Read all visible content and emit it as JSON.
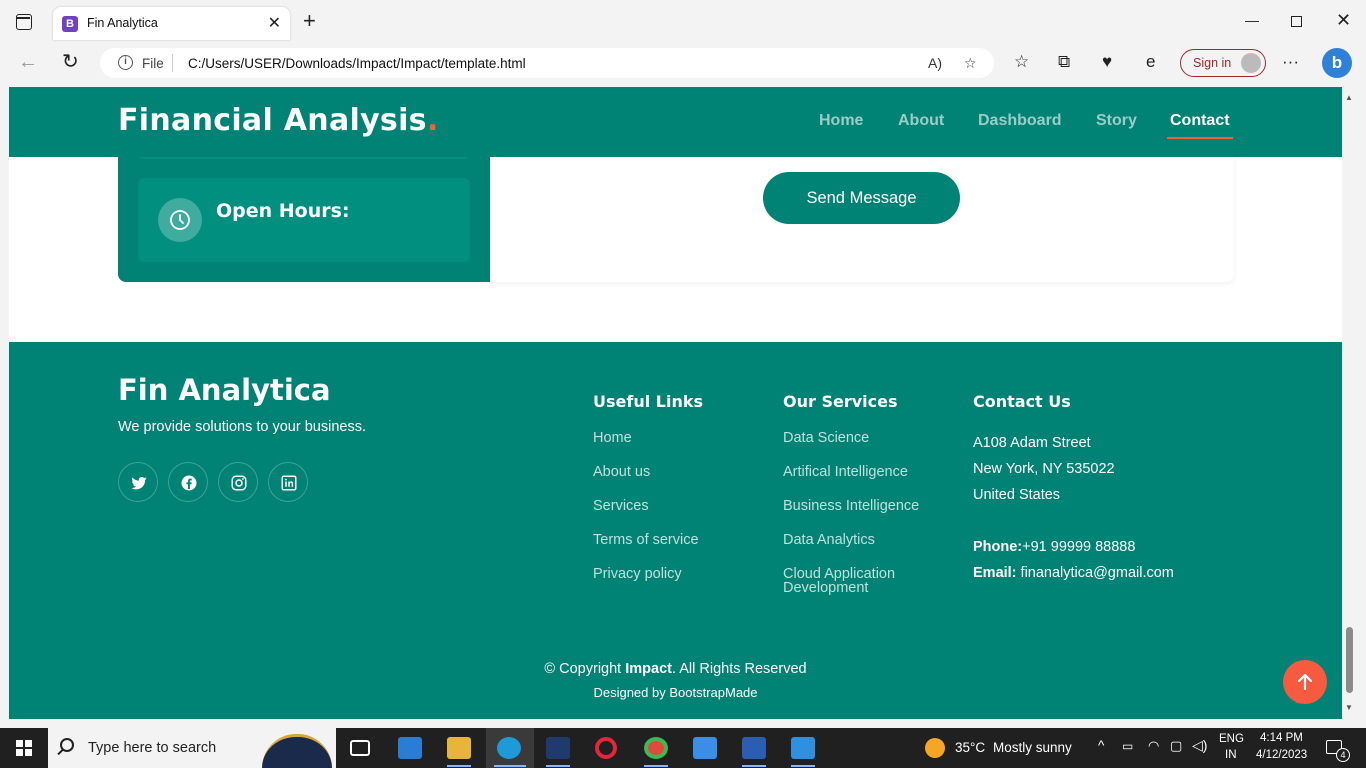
{
  "browser": {
    "tab_title": "Fin Analytica",
    "tab_favicon": "B",
    "address_label": "File",
    "url": "C:/Users/USER/Downloads/Impact/Impact/template.html",
    "signin_label": "Sign in",
    "bing_label": "b"
  },
  "header": {
    "logo": "Financial Analysis",
    "logo_dot": ".",
    "nav": [
      {
        "label": "Home",
        "active": false
      },
      {
        "label": "About",
        "active": false
      },
      {
        "label": "Dashboard",
        "active": false
      },
      {
        "label": "Story",
        "active": false
      },
      {
        "label": "Contact",
        "active": true
      }
    ]
  },
  "contact": {
    "info_label": "Open Hours:",
    "send_button": "Send Message"
  },
  "footer": {
    "brand": "Fin Analytica",
    "tagline": "We provide solutions to your business.",
    "social": [
      "twitter-icon",
      "facebook-icon",
      "instagram-icon",
      "linkedin-icon"
    ],
    "useful_links": {
      "heading": "Useful Links",
      "items": [
        "Home",
        "About us",
        "Services",
        "Terms of service",
        "Privacy policy"
      ]
    },
    "services": {
      "heading": "Our Services",
      "items": [
        "Data Science",
        "Artifical Intelligence",
        "Business Intelligence",
        "Data Analytics",
        "Cloud Application",
        "Development"
      ]
    },
    "contact": {
      "heading": "Contact Us",
      "address": [
        "A108 Adam Street",
        "New York, NY 535022",
        "United States"
      ],
      "phone_label": "Phone:",
      "phone": "+91 99999 88888",
      "email_label": "Email:",
      "email": "finanalytica@gmail.com"
    },
    "copyright_prefix": "© Copyright",
    "copyright_brand": "Impact",
    "copyright_suffix": ". All Rights Reserved",
    "credits": "Designed by BootstrapMade"
  },
  "taskbar": {
    "search_placeholder": "Type here to search",
    "weather_temp": "35°C",
    "weather_desc": "Mostly sunny",
    "lang_top": "ENG",
    "lang_bottom": "IN",
    "time": "4:14 PM",
    "date": "4/12/2023",
    "notification_count": "4"
  },
  "colors": {
    "brand_teal": "#008374",
    "accent_orange": "#f85a40"
  }
}
